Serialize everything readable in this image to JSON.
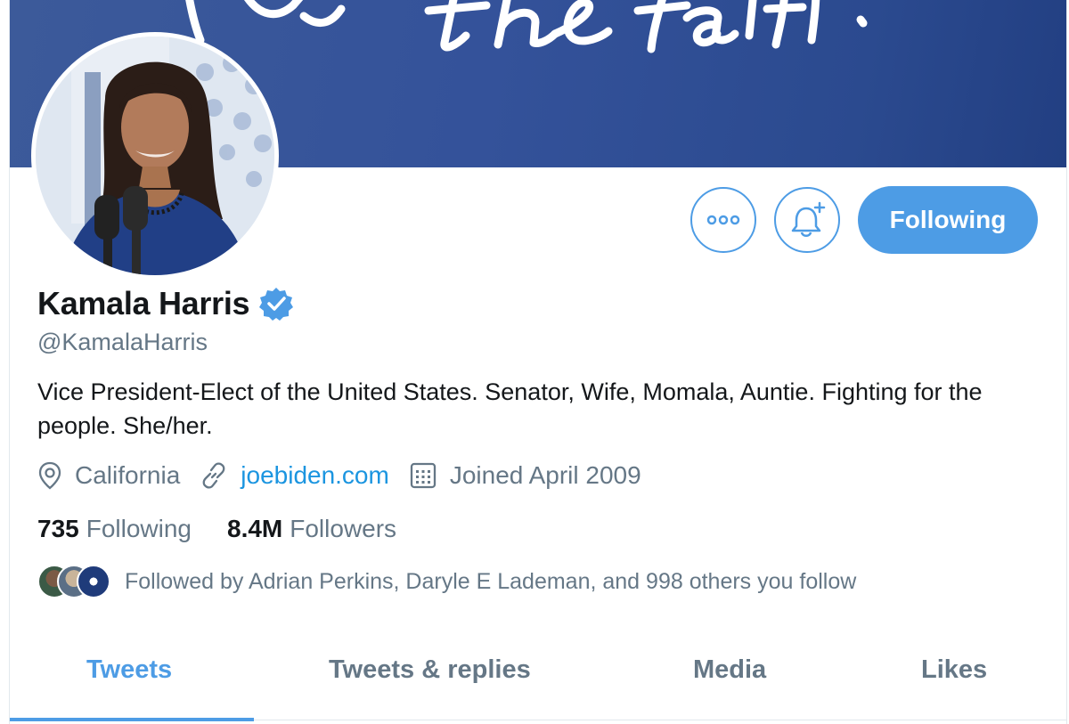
{
  "banner": {
    "script_text": "keep the faith."
  },
  "profile": {
    "name": "Kamala Harris",
    "handle": "@KamalaHarris",
    "bio": "Vice President-Elect of the United States. Senator, Wife, Momala, Auntie. Fighting for the people. She/her.",
    "verified": true
  },
  "actions": {
    "follow_label": "Following"
  },
  "meta": {
    "location": "California",
    "website": "joebiden.com",
    "joined": "Joined April 2009"
  },
  "counts": {
    "following_value": "735",
    "following_label": "Following",
    "followers_value": "8.4M",
    "followers_label": "Followers"
  },
  "followed_by": "Followed by Adrian Perkins, Daryle E Lademan, and 998 others you follow",
  "tabs": [
    {
      "label": "Tweets",
      "active": true
    },
    {
      "label": "Tweets & replies",
      "active": false
    },
    {
      "label": "Media",
      "active": false
    },
    {
      "label": "Likes",
      "active": false
    }
  ],
  "colors": {
    "accent": "#4d9ce5",
    "banner": "#34529a",
    "text": "#14171a",
    "muted": "#657786",
    "link": "#1b95e0"
  }
}
